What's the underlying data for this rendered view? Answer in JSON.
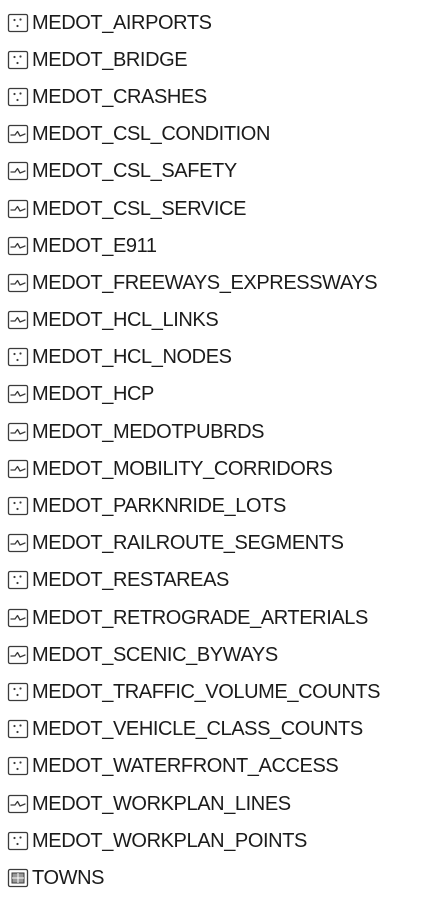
{
  "layers": [
    {
      "label": "MEDOT_AIRPORTS",
      "icon": "point-feature-class-icon"
    },
    {
      "label": "MEDOT_BRIDGE",
      "icon": "point-feature-class-icon"
    },
    {
      "label": "MEDOT_CRASHES",
      "icon": "point-feature-class-icon"
    },
    {
      "label": "MEDOT_CSL_CONDITION",
      "icon": "line-feature-class-icon"
    },
    {
      "label": "MEDOT_CSL_SAFETY",
      "icon": "line-feature-class-icon"
    },
    {
      "label": "MEDOT_CSL_SERVICE",
      "icon": "line-feature-class-icon"
    },
    {
      "label": "MEDOT_E911",
      "icon": "line-feature-class-icon"
    },
    {
      "label": "MEDOT_FREEWAYS_EXPRESSWAYS",
      "icon": "line-feature-class-icon"
    },
    {
      "label": "MEDOT_HCL_LINKS",
      "icon": "line-feature-class-icon"
    },
    {
      "label": "MEDOT_HCL_NODES",
      "icon": "point-feature-class-icon"
    },
    {
      "label": "MEDOT_HCP",
      "icon": "line-feature-class-icon"
    },
    {
      "label": "MEDOT_MEDOTPUBRDS",
      "icon": "line-feature-class-icon"
    },
    {
      "label": "MEDOT_MOBILITY_CORRIDORS",
      "icon": "line-feature-class-icon"
    },
    {
      "label": "MEDOT_PARKNRIDE_LOTS",
      "icon": "point-feature-class-icon"
    },
    {
      "label": "MEDOT_RAILROUTE_SEGMENTS",
      "icon": "line-feature-class-icon"
    },
    {
      "label": "MEDOT_RESTAREAS",
      "icon": "point-feature-class-icon"
    },
    {
      "label": "MEDOT_RETROGRADE_ARTERIALS",
      "icon": "line-feature-class-icon"
    },
    {
      "label": "MEDOT_SCENIC_BYWAYS",
      "icon": "line-feature-class-icon"
    },
    {
      "label": "MEDOT_TRAFFIC_VOLUME_COUNTS",
      "icon": "point-feature-class-icon"
    },
    {
      "label": "MEDOT_VEHICLE_CLASS_COUNTS",
      "icon": "point-feature-class-icon"
    },
    {
      "label": "MEDOT_WATERFRONT_ACCESS",
      "icon": "point-feature-class-icon"
    },
    {
      "label": "MEDOT_WORKPLAN_LINES",
      "icon": "line-feature-class-icon"
    },
    {
      "label": "MEDOT_WORKPLAN_POINTS",
      "icon": "point-feature-class-icon"
    },
    {
      "label": "TOWNS",
      "icon": "polygon-feature-class-icon"
    }
  ],
  "colors": {
    "icon_border": "#3b3b3b",
    "icon_fill": "#ffffff",
    "polygon_fill": "#9a9a9a",
    "text": "#1b1b1b"
  }
}
